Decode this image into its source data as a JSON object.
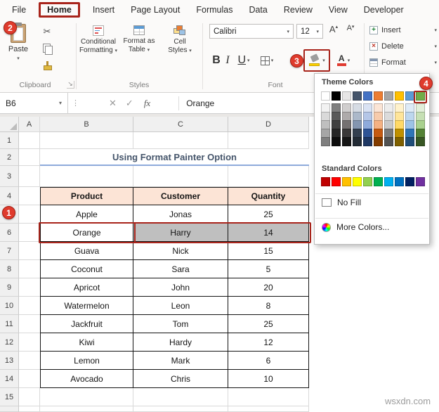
{
  "ribbon": {
    "tabs": [
      "File",
      "Home",
      "Insert",
      "Page Layout",
      "Formulas",
      "Data",
      "Review",
      "View",
      "Developer"
    ],
    "active_tab": "Home",
    "clipboard": {
      "paste": "Paste",
      "group": "Clipboard"
    },
    "styles": {
      "b1l1": "Conditional",
      "b1l2": "Formatting",
      "b2l1": "Format as",
      "b2l2": "Table",
      "b3l1": "Cell",
      "b3l2": "Styles",
      "group": "Styles"
    },
    "font": {
      "name": "Calibri",
      "size": "12",
      "bold": "B",
      "italic": "I",
      "underline": "U",
      "group": "Font"
    },
    "cells": {
      "insert": "Insert",
      "delete": "Delete",
      "format": "Format"
    }
  },
  "formula_bar": {
    "name_box": "B6",
    "fx": "fx",
    "value": "Orange"
  },
  "color_picker": {
    "theme_label": "Theme Colors",
    "standard_label": "Standard Colors",
    "no_fill": "No Fill",
    "more_colors": "More Colors...",
    "theme_colors": [
      "#FFFFFF",
      "#000000",
      "#E7E6E6",
      "#44546A",
      "#4472C4",
      "#ED7D31",
      "#A5A5A5",
      "#FFC000",
      "#5B9BD5",
      "#70AD47"
    ],
    "theme_variant_rows": [
      [
        "#F2F2F2",
        "#7F7F7F",
        "#D0CECE",
        "#D6DCE4",
        "#D9E2F3",
        "#FBE5D6",
        "#EDEDED",
        "#FFF2CC",
        "#DEEBF7",
        "#E2EFDA"
      ],
      [
        "#D9D9D9",
        "#595959",
        "#AEAAAA",
        "#ACB9CA",
        "#B4C6E7",
        "#F7CBAC",
        "#DBDBDB",
        "#FFE599",
        "#BDD7EE",
        "#C6E0B4"
      ],
      [
        "#BFBFBF",
        "#404040",
        "#757171",
        "#8496B0",
        "#8EAADB",
        "#F4B183",
        "#C9C9C9",
        "#FFD966",
        "#9DC3E6",
        "#A9D18E"
      ],
      [
        "#A6A6A6",
        "#262626",
        "#3A3838",
        "#333F4F",
        "#2F5496",
        "#C55A11",
        "#7B7B7B",
        "#BF9000",
        "#2E75B6",
        "#548235"
      ],
      [
        "#7F7F7F",
        "#0D0D0D",
        "#161616",
        "#222B35",
        "#1F3864",
        "#833C00",
        "#525252",
        "#7F6000",
        "#1F4E79",
        "#375623"
      ]
    ],
    "standard_colors": [
      "#C00000",
      "#FF0000",
      "#FFC000",
      "#FFFF00",
      "#92D050",
      "#00B050",
      "#00B0F0",
      "#0070C0",
      "#002060",
      "#7030A0"
    ]
  },
  "grid": {
    "column_headers": [
      "A",
      "B",
      "C",
      "D"
    ],
    "row_numbers": [
      "1",
      "2",
      "3",
      "4",
      "5",
      "6",
      "7",
      "8",
      "9",
      "10",
      "11",
      "12",
      "13",
      "14",
      "15"
    ],
    "title": "Using Format Painter Option",
    "table": {
      "headers": [
        "Product",
        "Customer",
        "Quantity"
      ],
      "rows": [
        [
          "Apple",
          "Jonas",
          "25"
        ],
        [
          "Orange",
          "Harry",
          "14"
        ],
        [
          "Guava",
          "Nick",
          "15"
        ],
        [
          "Coconut",
          "Sara",
          "5"
        ],
        [
          "Apricot",
          "John",
          "20"
        ],
        [
          "Watermelon",
          "Leon",
          "8"
        ],
        [
          "Jackfruit",
          "Tom",
          "25"
        ],
        [
          "Kiwi",
          "Hardy",
          "12"
        ],
        [
          "Lemon",
          "Mark",
          "6"
        ],
        [
          "Avocado",
          "Chris",
          "10"
        ]
      ]
    }
  },
  "annotations": {
    "s1": "1",
    "s2": "2",
    "s3": "3",
    "s4": "4"
  },
  "colors": {
    "annotation_red": "#A8241B",
    "table_header_fill": "#FCE4D6",
    "selected_cells_fill": "#BFBFBF",
    "title_text": "#44546A",
    "title_underline": "#8EAADB",
    "highlighted_theme_color": "#70AD47"
  },
  "watermark": "wsxdn.com"
}
